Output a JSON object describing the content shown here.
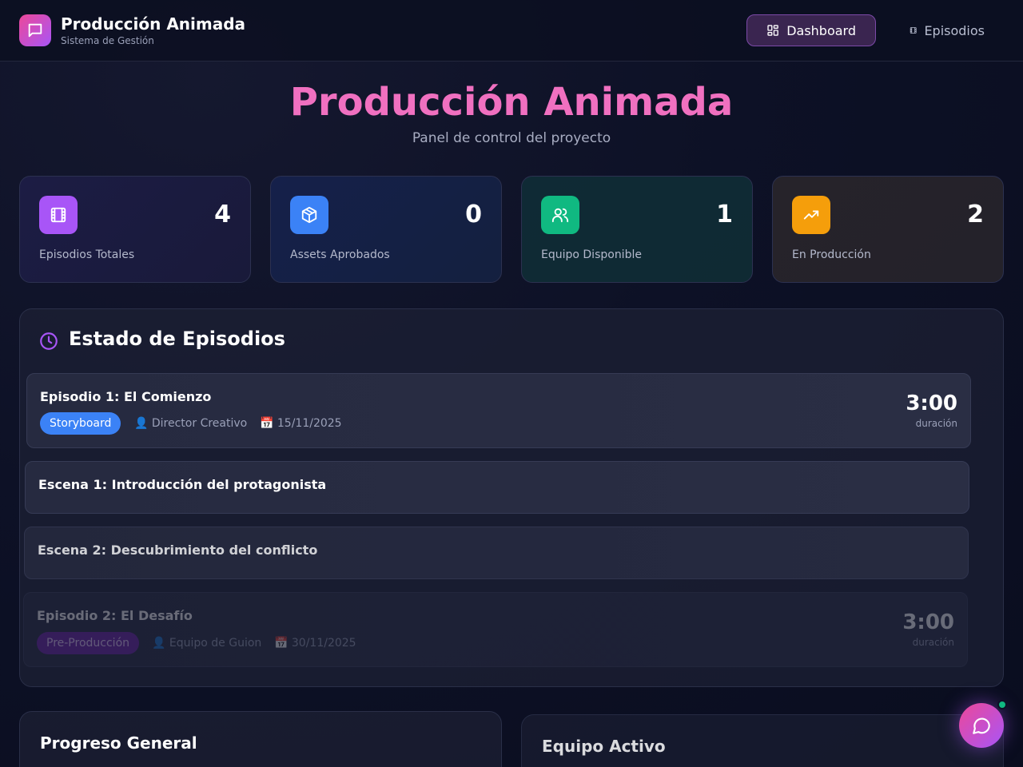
{
  "header": {
    "title": "Producción Animada",
    "subtitle": "Sistema de Gestión",
    "nav": [
      {
        "label": "Dashboard",
        "icon": "grid-icon",
        "active": true
      },
      {
        "label": "Episodios",
        "icon": "film-icon",
        "active": false
      }
    ]
  },
  "hero": {
    "title": "Producción Animada",
    "subtitle": "Panel de control del proyecto"
  },
  "stats": [
    {
      "label": "Episodios Totales",
      "value": "4",
      "icon": "film-icon",
      "color": "#a855f7"
    },
    {
      "label": "Assets Aprobados",
      "value": "0",
      "icon": "box-icon",
      "color": "#3b82f6"
    },
    {
      "label": "Equipo Disponible",
      "value": "1",
      "icon": "users-icon",
      "color": "#10b981"
    },
    {
      "label": "En Producción",
      "value": "2",
      "icon": "trending-up-icon",
      "color": "#f59e0b"
    }
  ],
  "episodes_panel": {
    "title": "Estado de Episodios",
    "icon": "clock-icon",
    "episodes": [
      {
        "title": "Episodio 1: El Comienzo",
        "stage": "Storyboard",
        "stage_color": "#3b82f6",
        "owner": "👤 Director Creativo",
        "date": "📅 15/11/2025",
        "duration": "3:00",
        "duration_label": "duración"
      },
      {
        "title": "Episodio 2: El Desafío",
        "stage": "Pre-Producción",
        "stage_color": "#6b21a8",
        "owner": "👤 Equipo de Guion",
        "date": "📅 30/11/2025",
        "duration": "3:00",
        "duration_label": "duración"
      }
    ],
    "scenes": [
      {
        "title": "Escena 1: Introducción del protagonista"
      },
      {
        "title": "Escena 2: Descubrimiento del conflicto"
      }
    ]
  },
  "bottom": {
    "progress_title": "Progreso General",
    "team_title": "Equipo Activo"
  },
  "chat": {
    "icon": "chat-icon",
    "online_color": "#10b981"
  }
}
